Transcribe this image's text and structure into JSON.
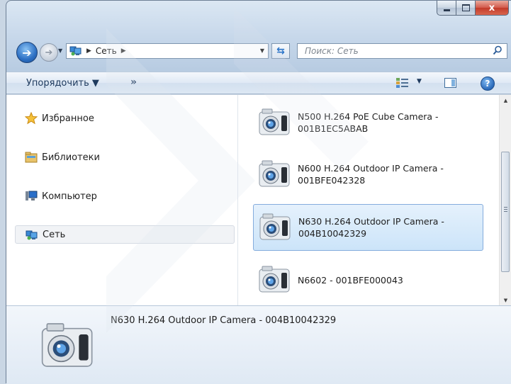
{
  "window": {
    "controls": {
      "minimize": "minimize",
      "maximize": "maximize",
      "close": "x"
    }
  },
  "nav": {
    "breadcrumb": [
      "Сеть"
    ],
    "search_placeholder": "Поиск: Сеть"
  },
  "toolbar": {
    "organize_label": "Упорядочить ▼",
    "more_label": "»",
    "view_drop": "▼"
  },
  "navpane": {
    "items": [
      {
        "label": "Избранное",
        "icon": "star-icon"
      },
      {
        "label": "Библиотеки",
        "icon": "libraries-icon"
      },
      {
        "label": "Компьютер",
        "icon": "computer-icon"
      },
      {
        "label": "Сеть",
        "icon": "network-icon",
        "selected": true
      }
    ]
  },
  "files": {
    "items": [
      {
        "name": "N500 H.264 PoE Cube Camera - 001B1EC5ABAB",
        "line1": "N500 H.264 PoE Cube Camera -",
        "line2": "001B1EC5ABAB",
        "icon": "camera-icon"
      },
      {
        "name": "N600 H.264 Outdoor IP Camera - 001BFE042328",
        "line1": "N600 H.264 Outdoor IP Camera -",
        "line2": "001BFE042328",
        "icon": "camera-icon"
      },
      {
        "name": "N630 H.264 Outdoor IP Camera - 004B10042329",
        "line1": "N630 H.264 Outdoor IP Camera -",
        "line2": "004B10042329",
        "icon": "camera-icon",
        "selected": true
      },
      {
        "name": "N6602 - 001BFE000043",
        "line1": "N6602 - 001BFE000043",
        "line2": "",
        "icon": "camera-icon"
      }
    ]
  },
  "details": {
    "name": "N630 H.264 Outdoor IP Camera - 004B10042329"
  },
  "colors": {
    "selection": "#cce4f9",
    "selection_border": "#84acdd",
    "accent": "#2a73c8"
  }
}
